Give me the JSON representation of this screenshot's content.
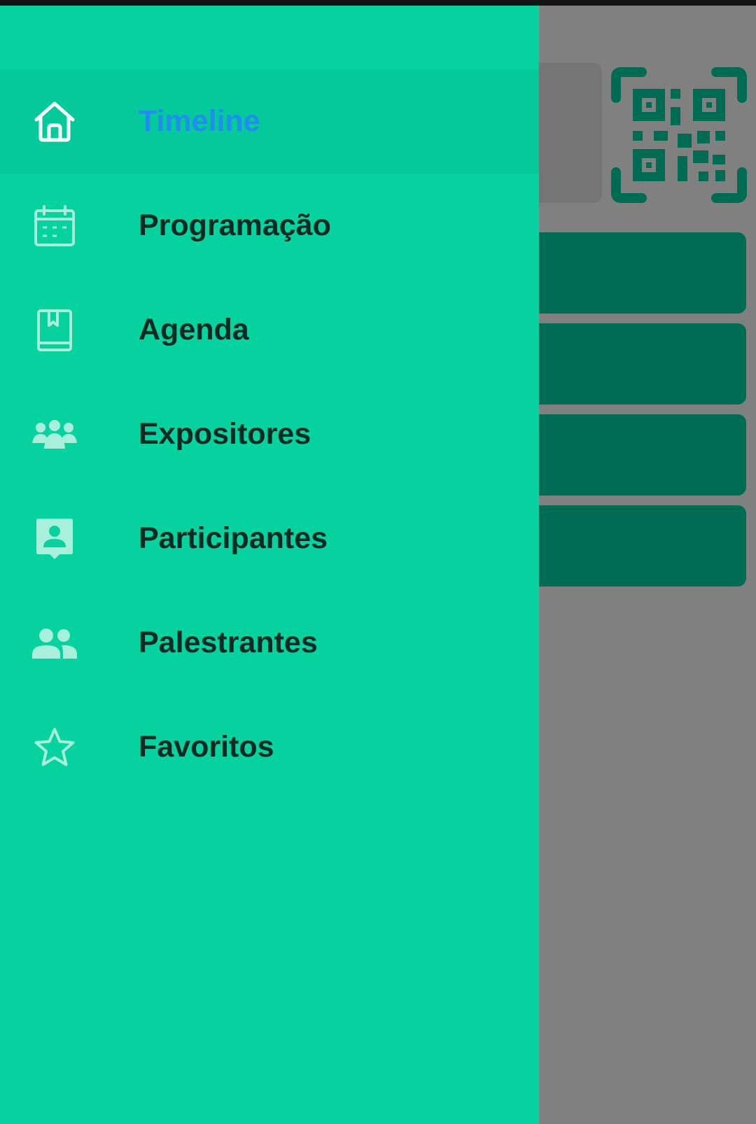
{
  "drawer": {
    "items": [
      {
        "label": "Timeline",
        "icon": "home-icon",
        "active": true
      },
      {
        "label": "Programação",
        "icon": "calendar-icon",
        "active": false
      },
      {
        "label": "Agenda",
        "icon": "book-icon",
        "active": false
      },
      {
        "label": "Expositores",
        "icon": "group-icon",
        "active": false
      },
      {
        "label": "Participantes",
        "icon": "contact-badge-icon",
        "active": false
      },
      {
        "label": "Palestrantes",
        "icon": "people-icon",
        "active": false
      },
      {
        "label": "Favoritos",
        "icon": "star-icon",
        "active": false
      }
    ]
  },
  "background": {
    "qr_icon": "qr-code-icon",
    "card_count": 4
  },
  "colors": {
    "drawer_bg": "#05d29f",
    "active_item_bg": "#04c99a",
    "active_label": "#1f8ef0",
    "label": "#0f2a22",
    "scrim": "#808080",
    "card": "#006b53"
  }
}
